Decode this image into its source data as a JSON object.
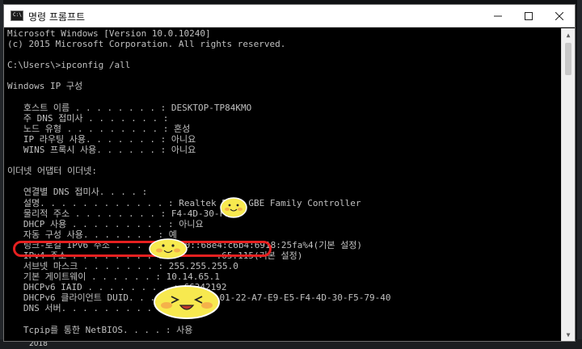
{
  "window": {
    "title": "명령 프롬프트",
    "app_icon_text": "C:\\"
  },
  "console": {
    "lines": [
      "Microsoft Windows [Version 10.0.10240]",
      "(c) 2015 Microsoft Corporation. All rights reserved.",
      "",
      "C:\\Users\\>ipconfig /all",
      "",
      "Windows IP 구성",
      "",
      "   호스트 이름 . . . . . . . . : DESKTOP-TP84KMO",
      "   주 DNS 접미사 . . . . . . . :",
      "   노드 유형 . . . . . . . . . : 혼성",
      "   IP 라우팅 사용. . . . . . . : 아니요",
      "   WINS 프록시 사용. . . . . . : 아니요",
      "",
      "이더넷 어댑터 이더넷:",
      "",
      "   연결별 DNS 접미사. . . . :",
      "   설명. . . . . . . . . . . . : Realtek PCIe GBE Family Controller",
      "   물리적 주소 . . . . . . . . : F4-4D-30-F5-",
      "   DHCP 사용 . . . . . . . . . : 아니요",
      "   자동 구성 사용. . . . . . . : 예",
      "   링크-로컬 IPv6 주소 . . . . : fe80::68e4:c6b4:6918:25fa%4(기본 설정)",
      "   IPv4 주소 . . . . . . . . . :        .65.115(기본 설정)",
      "   서브넷 마스크 . . . . . . . : 255.255.255.0",
      "   기본 게이트웨이 . . . . . . : 10.14.65.1",
      "   DHCPv6 IAID . . . . . . . . : 66342192",
      "   DHCPv6 클라이언트 DUID. . . : 00-01-00-01-22-A7-E9-E5-F4-4D-30-F5-79-40",
      "   DNS 서버. . . . . . . . . . :",
      "",
      "   Tcpip를 통한 NetBIOS. . . . : 사용"
    ]
  },
  "taskbar": {
    "text": "2018"
  },
  "colors": {
    "console_bg": "#000000",
    "console_text": "#c0c0c0",
    "highlight": "#e62020",
    "sticker": "#f7e94f"
  }
}
